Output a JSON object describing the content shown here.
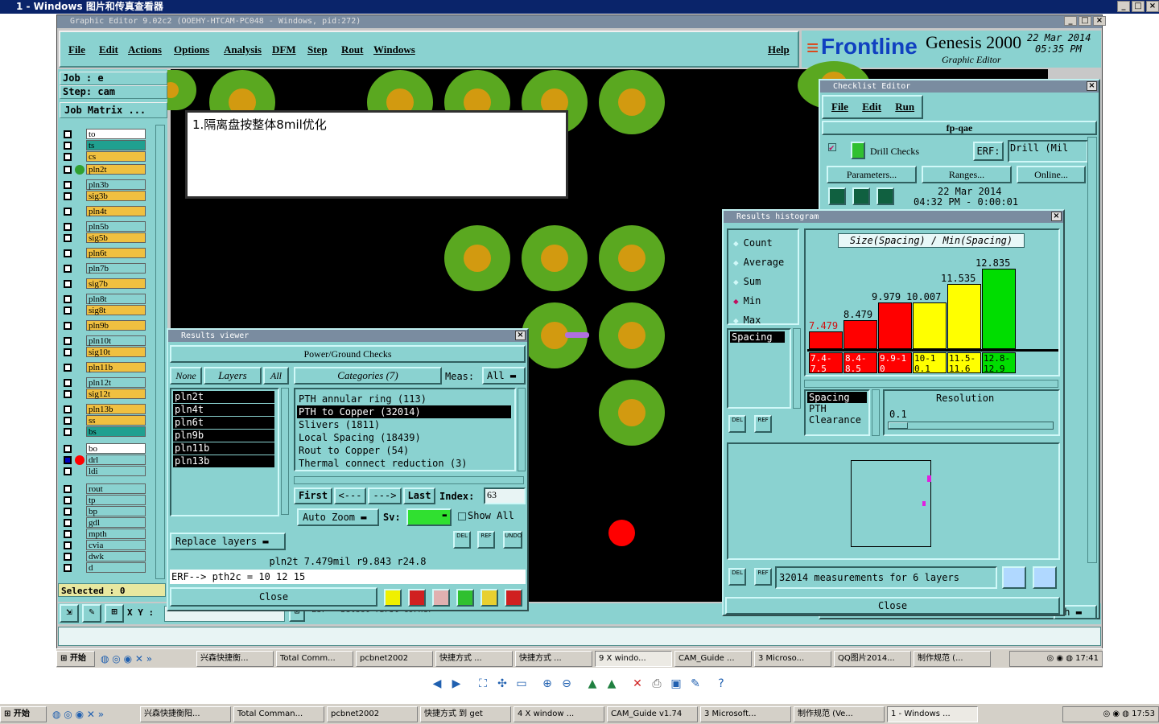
{
  "outer_window": {
    "title": "1 - Windows 图片和传真查看器"
  },
  "app": {
    "title": "Graphic Editor 9.02c2 (OOEHY-HTCAM-PC048 - Windows, pid:272)",
    "menu": [
      "File",
      "Edit",
      "Actions",
      "Options",
      "Analysis",
      "DFM",
      "Step",
      "Rout",
      "Windows"
    ],
    "help": "Help",
    "brand": "Frontline",
    "product": "Genesis 2000",
    "product_sub": "Graphic Editor",
    "date": "22 Mar 2014",
    "time": "05:35 PM"
  },
  "left": {
    "job": "Job  : e",
    "step": "Step: cam",
    "job_matrix": "Job Matrix ...",
    "selected": "Selected : 0",
    "xy_label": "X Y :",
    "layers": [
      {
        "name": "to",
        "color": "#ffffff"
      },
      {
        "name": "ts",
        "color": "#20a090"
      },
      {
        "name": "cs",
        "color": "#f0c040"
      },
      {
        "name": "pln2t",
        "color": "#f0c040",
        "active": true
      },
      {
        "name": "pln3b",
        "color": "#8ad2d0"
      },
      {
        "name": "sig3b",
        "color": "#f0c040"
      },
      {
        "name": "pln4t",
        "color": "#f0c040"
      },
      {
        "name": "pln5b",
        "color": "#8ad2d0"
      },
      {
        "name": "sig5b",
        "color": "#f0c040"
      },
      {
        "name": "pln6t",
        "color": "#f0c040"
      },
      {
        "name": "pln7b",
        "color": "#8ad2d0"
      },
      {
        "name": "sig7b",
        "color": "#f0c040"
      },
      {
        "name": "pln8t",
        "color": "#8ad2d0"
      },
      {
        "name": "sig8t",
        "color": "#f0c040"
      },
      {
        "name": "pln9b",
        "color": "#f0c040"
      },
      {
        "name": "pln10t",
        "color": "#8ad2d0"
      },
      {
        "name": "sig10t",
        "color": "#f0c040"
      },
      {
        "name": "pln11b",
        "color": "#f0c040"
      },
      {
        "name": "pln12t",
        "color": "#8ad2d0"
      },
      {
        "name": "sig12t",
        "color": "#f0c040"
      },
      {
        "name": "pln13b",
        "color": "#f0c040"
      },
      {
        "name": "ss",
        "color": "#f0c040"
      },
      {
        "name": "bs",
        "color": "#20a090"
      },
      {
        "name": "bo",
        "color": "#ffffff"
      },
      {
        "name": "drl",
        "color": "#8ad2d0",
        "drill": true
      },
      {
        "name": "ldi",
        "color": "#8ad2d0"
      },
      {
        "name": "rout",
        "color": "#8ad2d0"
      },
      {
        "name": "tp",
        "color": "#8ad2d0"
      },
      {
        "name": "bp",
        "color": "#8ad2d0"
      },
      {
        "name": "gdl",
        "color": "#8ad2d0"
      },
      {
        "name": "mpth",
        "color": "#8ad2d0"
      },
      {
        "name": "cvia",
        "color": "#8ad2d0"
      },
      {
        "name": "dwk",
        "color": "#8ad2d0"
      },
      {
        "name": "d",
        "color": "#8ad2d0"
      }
    ]
  },
  "annotation": {
    "text": "1.隔离盘按整体8mil优化"
  },
  "status_line": {
    "text": "Ld7 - Select first corner"
  },
  "results_viewer": {
    "title": "Results viewer",
    "header": "Power/Ground Checks",
    "layer_btns": [
      "None",
      "Layers",
      "All"
    ],
    "categories_label": "Categories (7)",
    "meas_label": "Meas:",
    "meas_value": "All",
    "layer_list": [
      "pln2t",
      "pln4t",
      "pln6t",
      "pln9b",
      "pln11b",
      "pln13b"
    ],
    "categories": [
      "PTH annular ring (113)",
      "PTH to Copper (32014)",
      "Slivers (1811)",
      "Local Spacing (18439)",
      "Rout to Copper (54)",
      "Thermal connect reduction (3)"
    ],
    "nav": [
      "First",
      "<---",
      "--->",
      "Last"
    ],
    "index_label": "Index:",
    "index_value": "63",
    "auto_zoom": "Auto Zoom",
    "sv_label": "Sv:",
    "show_all": "Show All",
    "replace_layers": "Replace layers",
    "info": "pln2t 7.479mil   r9.843   r24.8",
    "erf": "ERF--> pth2c = 10 12 15",
    "close": "Close",
    "small_btns": [
      "DEL",
      "REF",
      "UNDO"
    ]
  },
  "checklist": {
    "title": "Checklist Editor",
    "menu": [
      "File",
      "Edit",
      "Run"
    ],
    "name": "fp-qae",
    "drill_checks": "Drill Checks",
    "erf_label": "ERF:",
    "erf_value": "Drill  (Mil",
    "buttons": [
      "Parameters...",
      "Ranges...",
      "Online..."
    ],
    "date": "22 Mar 2014",
    "time_line": "04:32 PM - 0:00:01",
    "bottom_btn": "ch"
  },
  "histogram": {
    "title": "Results histogram",
    "options": [
      {
        "label": "Count",
        "selected": false
      },
      {
        "label": "Average",
        "selected": false
      },
      {
        "label": "Sum",
        "selected": false
      },
      {
        "label": "Min",
        "selected": true
      },
      {
        "label": "Max",
        "selected": false
      }
    ],
    "list_item": "Spacing",
    "chart_title": "Size(Spacing) / Min(Spacing)",
    "bottom_list": [
      "Spacing",
      "PTH",
      "Clearance"
    ],
    "resolution_label": "Resolution",
    "resolution_value": "0.1",
    "measurements": "32014 measurements for 6 layers",
    "close": "Close",
    "small_btns": [
      "DEL",
      "REF"
    ]
  },
  "chart_data": {
    "type": "bar",
    "title": "Size(Spacing) / Min(Spacing)",
    "categories": [
      "7.4-7.5",
      "8.4-8.5",
      "9.9-10",
      "10-10.1",
      "11.5-11.6",
      "12.8-12.9"
    ],
    "values": [
      7.479,
      8.479,
      9.979,
      10.007,
      11.535,
      12.835
    ],
    "value_labels": [
      "7.479",
      "8.479",
      "9.979",
      "10.007",
      "11.535",
      "12.835"
    ],
    "colors": [
      "#ff0000",
      "#ff0000",
      "#ff0000",
      "#ffff00",
      "#ffff00",
      "#00dd00"
    ],
    "ylim": [
      6,
      13
    ]
  },
  "taskbar_inner": {
    "start": "开始",
    "items": [
      "兴森快捷衡...",
      "Total Comm...",
      "pcbnet2002",
      "快捷方式 ...",
      "快捷方式 ...",
      "9 X windo...",
      "CAM_Guide ...",
      "3 Microso...",
      "QQ图片2014...",
      "制作规范 (..."
    ],
    "clock": "17:41"
  },
  "taskbar_outer": {
    "start": "开始",
    "items": [
      "兴森快捷衡阳...",
      "Total Comman...",
      "pcbnet2002",
      "快捷方式 到 get",
      "4 X window ...",
      "CAM_Guide v1.74",
      "3 Microsoft...",
      "制作规范 (Ve...",
      "1 - Windows ..."
    ],
    "clock": "17:53"
  }
}
